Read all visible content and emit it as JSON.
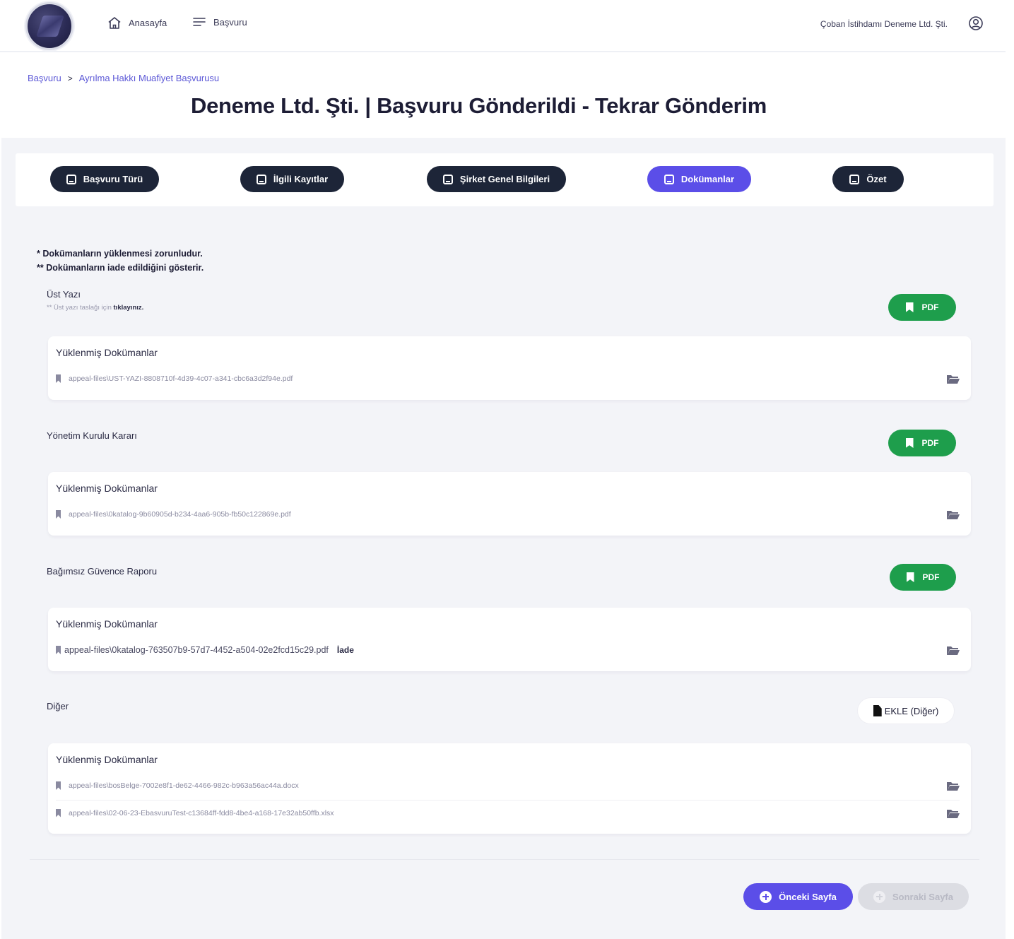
{
  "header": {
    "nav": [
      {
        "label": "Anasayfa",
        "icon": "home-icon"
      },
      {
        "label": "Başvuru",
        "icon": "menu-icon"
      }
    ],
    "company_name": "Çoban İstihdamı Deneme Ltd. Şti.",
    "user_icon": "user-circle-icon"
  },
  "breadcrumb": {
    "items": [
      "Başvuru",
      "Ayrılma Hakkı Muafiyet Başvurusu"
    ],
    "separator": ">"
  },
  "page_title": "Deneme Ltd. Şti. | Başvuru Gönderildi - Tekrar Gönderim",
  "steps": [
    {
      "label": "Başvuru Türü",
      "active": false
    },
    {
      "label": "İlgili Kayıtlar",
      "active": false
    },
    {
      "label": "Şirket Genel Bilgileri",
      "active": false
    },
    {
      "label": "Dokümanlar",
      "active": true
    },
    {
      "label": "Özet",
      "active": false
    }
  ],
  "notes": {
    "line1": "*  Dokümanların yüklenmesi zorunludur.",
    "line2": "** Dokümanların iade edildiğini gösterir."
  },
  "sections": {
    "ust_yazi": {
      "label": "Üst Yazı",
      "sub_prefix": "** Üst yazı taslağı için",
      "sub_link": "tıklayınız.",
      "button": "PDF",
      "card_title": "Yüklenmiş Dokümanlar",
      "files": [
        "appeal-files\\UST-YAZI-8808710f-4d39-4c07-a341-cbc6a3d2f94e.pdf"
      ]
    },
    "yonetim": {
      "label": "Yönetim Kurulu Kararı",
      "button": "PDF",
      "card_title": "Yüklenmiş Dokümanlar",
      "files": [
        "appeal-files\\0katalog-9b60905d-b234-4aa6-905b-fb50c122869e.pdf"
      ]
    },
    "guvence": {
      "label": "Bağımsız Güvence Raporu",
      "button": "PDF",
      "card_title": "Yüklenmiş Dokümanlar",
      "files": [
        "appeal-files\\0katalog-763507b9-57d7-4452-a504-02e2fcd15c29.pdf"
      ],
      "iade_label": "İade"
    },
    "diger": {
      "label": "Diğer",
      "button": "EKLE (Diğer)",
      "card_title": "Yüklenmiş Dokümanlar",
      "files": [
        "appeal-files\\bosBelge-7002e8f1-de62-4466-982c-b963a56ac44a.docx",
        "appeal-files\\02-06-23-EbasvuruTest-c13684ff-fdd8-4be4-a168-17e32ab50ffb.xlsx"
      ]
    }
  },
  "footer": {
    "prev_label": "Önceki Sayfa",
    "next_label": "Sonraki Sayfa"
  },
  "colors": {
    "accent": "#5b4ee8",
    "step_dark": "#1d2538",
    "pdf_green": "#1e9e4c",
    "breadcrumb": "#5b57d6"
  }
}
